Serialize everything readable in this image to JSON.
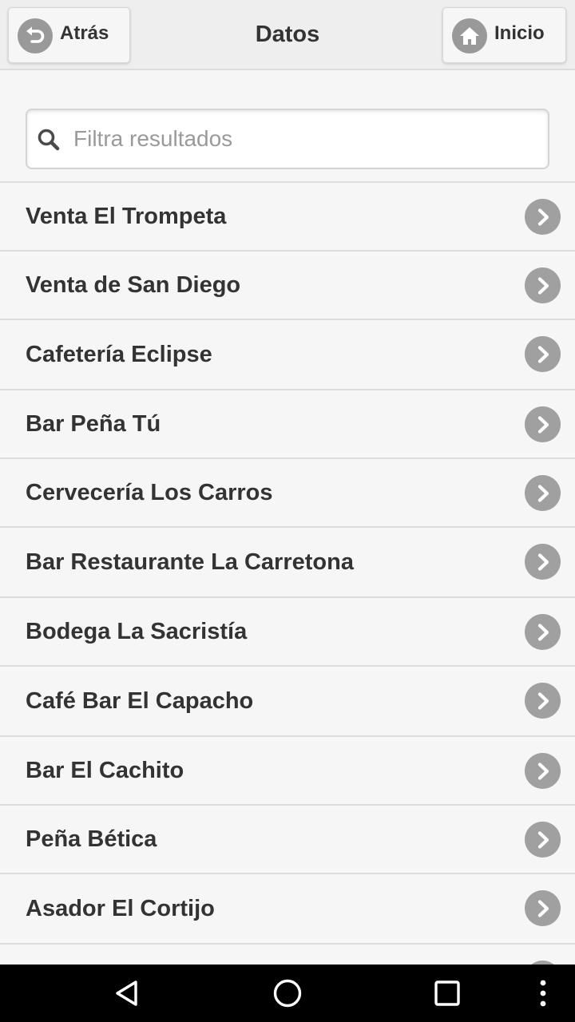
{
  "header": {
    "title": "Datos",
    "back_label": "Atrás",
    "back_icon": "undo-arrow-icon",
    "home_label": "Inicio",
    "home_icon": "house-icon"
  },
  "search": {
    "placeholder": "Filtra resultados",
    "value": "",
    "icon": "magnifier-icon"
  },
  "list": {
    "items": [
      {
        "label": "Venta El Trompeta"
      },
      {
        "label": "Venta de San Diego"
      },
      {
        "label": "Cafetería Eclipse"
      },
      {
        "label": "Bar Peña Tú"
      },
      {
        "label": "Cervecería Los Carros"
      },
      {
        "label": "Bar Restaurante La Carretona"
      },
      {
        "label": "Bodega La Sacristía"
      },
      {
        "label": "Café Bar El Capacho"
      },
      {
        "label": "Bar El Cachito"
      },
      {
        "label": "Peña Bética"
      },
      {
        "label": "Asador El Cortijo"
      },
      {
        "label": ""
      }
    ],
    "item_icon": "chevron-right-circle-icon"
  },
  "system_nav": {
    "back_icon": "triangle-back-icon",
    "home_icon": "circle-home-icon",
    "recents_icon": "square-recents-icon",
    "menu_icon": "three-dots-menu-icon"
  },
  "colors": {
    "header_bg": "#eeeeee",
    "page_bg": "#f6f6f6",
    "text": "#333333",
    "icon_disc": "#a0a0a0",
    "navbar_bg": "#000000"
  }
}
